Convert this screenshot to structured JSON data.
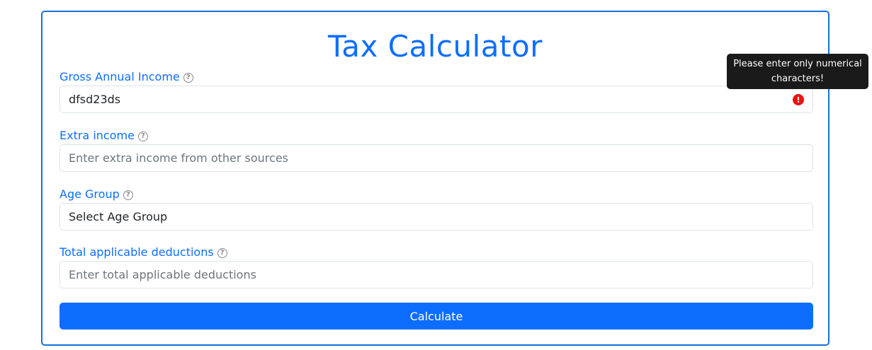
{
  "title": "Tax Calculator",
  "fields": [
    {
      "label": "Gross Annual Income",
      "value": "dfsd23ds",
      "placeholder": "",
      "help_icon": "question-circle-icon",
      "error_icon": "exclamation-circle-icon"
    },
    {
      "label": "Extra income",
      "value": "",
      "placeholder": "Enter extra income from other sources",
      "help_icon": "question-circle-icon"
    },
    {
      "label": "Age Group",
      "value": "Select Age Group",
      "placeholder": "",
      "help_icon": "question-circle-icon"
    },
    {
      "label": "Total applicable deductions",
      "value": "",
      "placeholder": "Enter total applicable deductions",
      "help_icon": "question-circle-icon"
    }
  ],
  "tooltip": {
    "text": "Please enter only numerical characters!"
  },
  "button": {
    "label": "Calculate"
  },
  "colors": {
    "accent": "#0d6efd",
    "error": "#ee1111",
    "tooltip_bg": "#1a1a1a"
  }
}
